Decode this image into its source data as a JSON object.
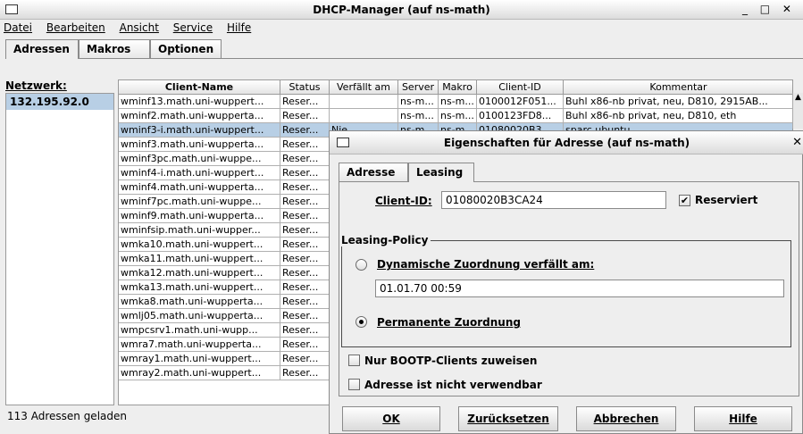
{
  "window": {
    "title": "DHCP-Manager (auf ns-math)",
    "controls": "_ □ ✕"
  },
  "menu": [
    "Datei",
    "Bearbeiten",
    "Ansicht",
    "Service",
    "Hilfe"
  ],
  "tabs": [
    "Adressen",
    "Makros",
    "Optionen"
  ],
  "network": {
    "label": "Netzwerk:",
    "value": "132.195.92.0"
  },
  "table": {
    "headers": [
      "Client-Name",
      "Status",
      "Verfällt am",
      "Server",
      "Makro",
      "Client-ID",
      "Kommentar"
    ],
    "rows": [
      [
        "wminf13.math.uni-wuppert...",
        "Reser...",
        "",
        "ns-m...",
        "ns-m...",
        "0100012F051...",
        "Buhl x86-nb privat, neu, D810, 2915AB..."
      ],
      [
        "wminf2.math.uni-wupperta...",
        "Reser...",
        "",
        "ns-m...",
        "ns-m...",
        "0100123FD8...",
        "Buhl x86-nb privat, neu, D810, eth"
      ],
      [
        "wminf3-i.math.uni-wuppert...",
        "Reser...",
        "Nie",
        "ns-m...",
        "ns-m...",
        "01080020B3...",
        "sparc ubuntu"
      ],
      [
        "wminf3.math.uni-wupperta...",
        "Reser...",
        "",
        "",
        "",
        "",
        ""
      ],
      [
        "wminf3pc.math.uni-wuppe...",
        "Reser...",
        "",
        "",
        "",
        "",
        ""
      ],
      [
        "wminf4-i.math.uni-wuppert...",
        "Reser...",
        "",
        "",
        "",
        "",
        ""
      ],
      [
        "wminf4.math.uni-wupperta...",
        "Reser...",
        "",
        "",
        "",
        "",
        ""
      ],
      [
        "wminf7pc.math.uni-wuppe...",
        "Reser...",
        "",
        "",
        "",
        "",
        ""
      ],
      [
        "wminf9.math.uni-wupperta...",
        "Reser...",
        "",
        "",
        "",
        "",
        ""
      ],
      [
        "wminfsip.math.uni-wupper...",
        "Reser...",
        "",
        "",
        "",
        "",
        ""
      ],
      [
        "wmka10.math.uni-wuppert...",
        "Reser...",
        "",
        "",
        "",
        "",
        ""
      ],
      [
        "wmka11.math.uni-wuppert...",
        "Reser...",
        "",
        "",
        "",
        "",
        ""
      ],
      [
        "wmka12.math.uni-wuppert...",
        "Reser...",
        "",
        "",
        "",
        "",
        ""
      ],
      [
        "wmka13.math.uni-wuppert...",
        "Reser...",
        "",
        "",
        "",
        "",
        ""
      ],
      [
        "wmka8.math.uni-wupperta...",
        "Reser...",
        "",
        "",
        "",
        "",
        ""
      ],
      [
        "wmlj05.math.uni-wupperta...",
        "Reser...",
        "",
        "",
        "",
        "",
        ""
      ],
      [
        "wmpcsrv1.math.uni-wupp...",
        "Reser...",
        "",
        "",
        "",
        "",
        ""
      ],
      [
        "wmra7.math.uni-wupperta...",
        "Reser...",
        "",
        "",
        "",
        "",
        ""
      ],
      [
        "wmray1.math.uni-wuppert...",
        "Reser...",
        "",
        "",
        "",
        "",
        ""
      ],
      [
        "wmray2.math.uni-wuppert...",
        "Reser...",
        "",
        "",
        "",
        "",
        ""
      ]
    ],
    "selected_row": 2
  },
  "status": "113 Adressen geladen",
  "dialog": {
    "title": "Eigenschaften für Adresse (auf ns-math)",
    "close": "✕",
    "tabs": [
      "Adresse",
      "Leasing"
    ],
    "client_id_label": "Client-ID:",
    "client_id_value": "01080020B3CA24",
    "reserviert_label": "Reserviert",
    "reserviert_checked": true,
    "policy_title": "Leasing-Policy",
    "dynamic_label": "Dynamische Zuordnung verfällt am:",
    "date_value": "01.01.70 00:59",
    "permanent_label": "Permanente Zuordnung",
    "bootp_label": "Nur BOOTP-Clients zuweisen",
    "unusable_label": "Adresse ist nicht verwendbar",
    "buttons": [
      "OK",
      "Zurücksetzen",
      "Abbrechen",
      "Hilfe"
    ]
  }
}
